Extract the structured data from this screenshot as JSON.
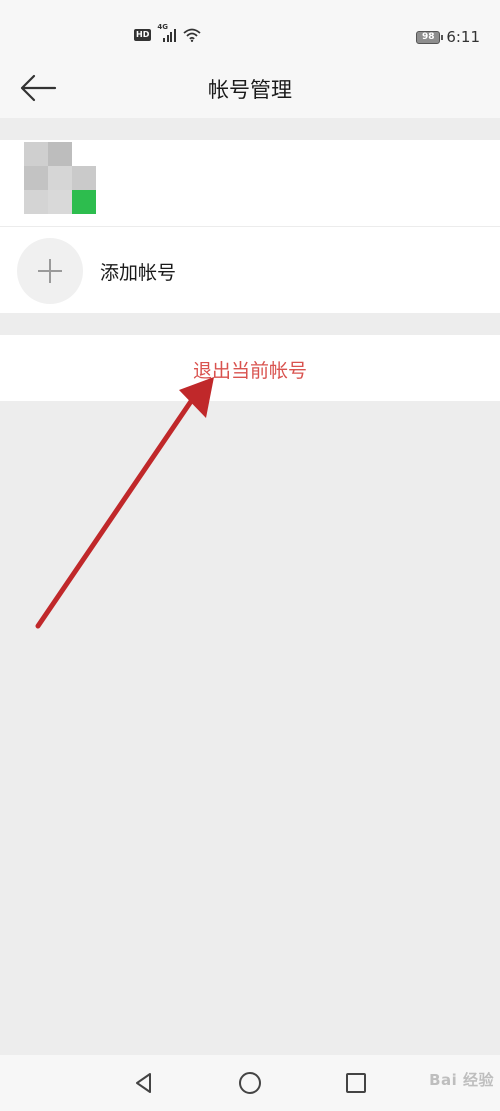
{
  "status_bar": {
    "hd_label": "HD",
    "network_label": "4G",
    "battery_level": "98",
    "time": "6:11"
  },
  "nav": {
    "title": "帐号管理",
    "back_icon": "arrow-left-icon"
  },
  "accounts": {
    "add_account_label": "添加帐号",
    "add_icon": "plus-icon"
  },
  "logout": {
    "label": "退出当前帐号",
    "color": "#d9534f"
  },
  "annotation": {
    "arrow_color": "#c0282a"
  },
  "system_nav": {
    "buttons": [
      "back-triangle-icon",
      "home-circle-icon",
      "recents-square-icon"
    ],
    "watermark": "Bai 经验"
  }
}
